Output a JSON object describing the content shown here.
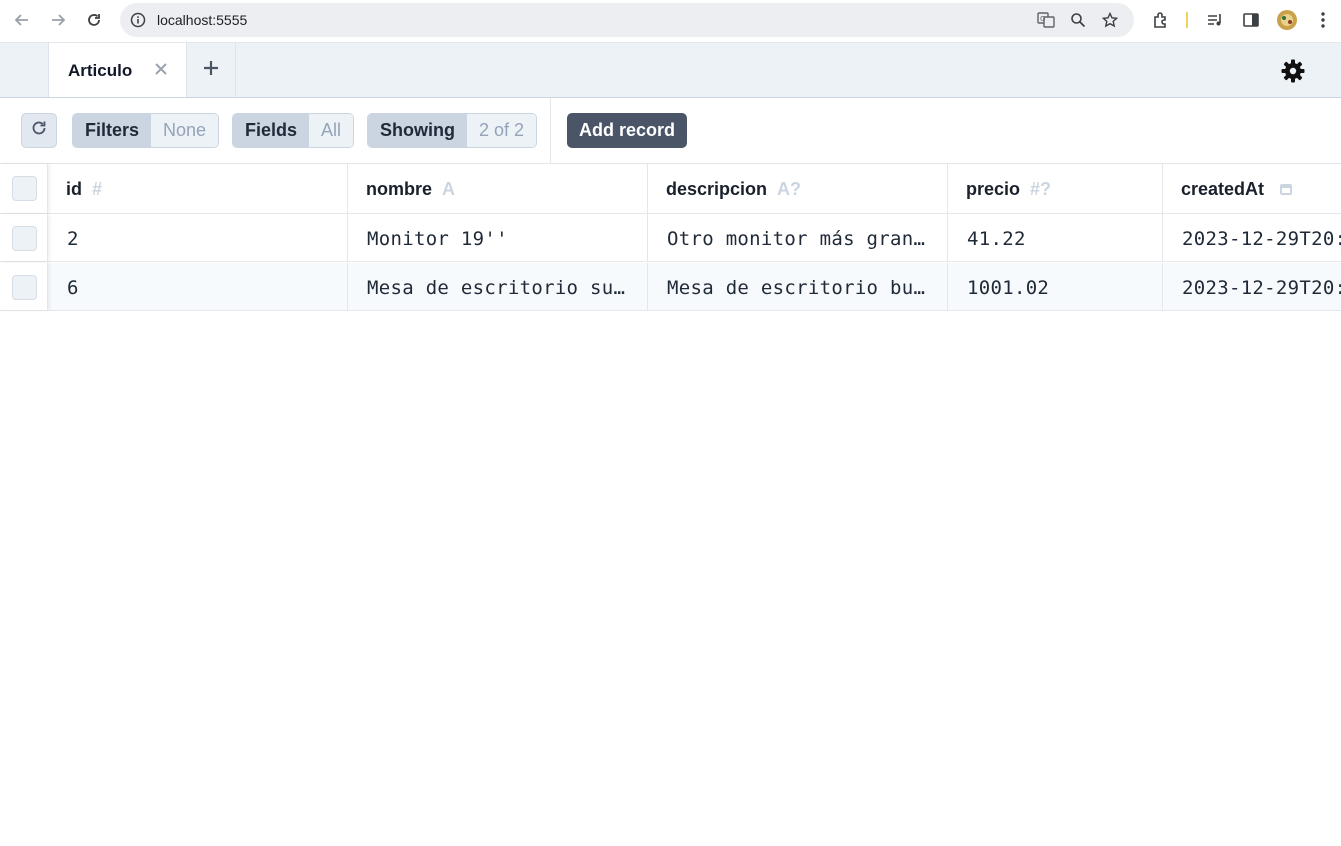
{
  "browser": {
    "url": "localhost:5555"
  },
  "tabs": {
    "active_label": "Articulo"
  },
  "toolbar": {
    "filters_label": "Filters",
    "filters_value": "None",
    "fields_label": "Fields",
    "fields_value": "All",
    "showing_label": "Showing",
    "showing_value": "2 of 2",
    "add_record_label": "Add record"
  },
  "table": {
    "columns": [
      {
        "name": "id",
        "type": "#"
      },
      {
        "name": "nombre",
        "type": "A"
      },
      {
        "name": "descripcion",
        "type": "A?"
      },
      {
        "name": "precio",
        "type": "#?"
      },
      {
        "name": "createdAt",
        "type": "calendar-icon"
      }
    ],
    "rows": [
      {
        "id": "2",
        "nombre": "Monitor 19''",
        "descripcion": "Otro monitor más gran…",
        "precio": "41.22",
        "createdAt": "2023-12-29T20:"
      },
      {
        "id": "6",
        "nombre": "Mesa de escritorio su…",
        "descripcion": "Mesa de escritorio bu…",
        "precio": "1001.02",
        "createdAt": "2023-12-29T20:"
      }
    ]
  },
  "colors": {
    "tabbar_bg": "#edf2f7",
    "group_label_bg": "#cbd5e1",
    "add_record_bg": "#4a5568",
    "row_alt_bg": "#f7fafc"
  }
}
